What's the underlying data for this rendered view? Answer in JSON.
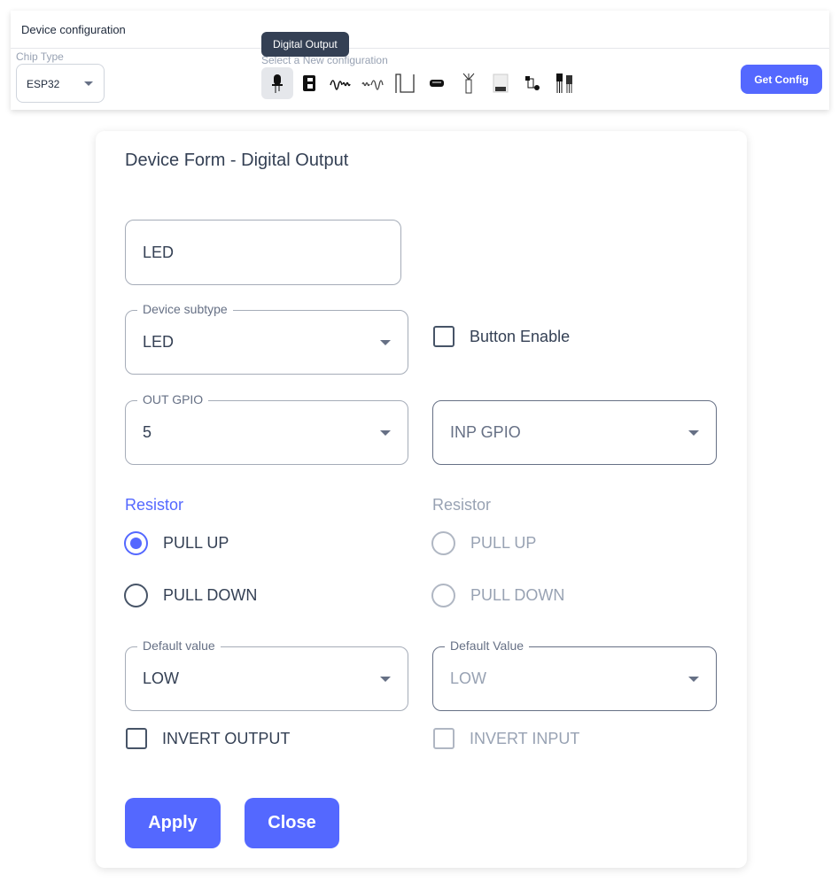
{
  "header": {
    "title": "Device configuration",
    "chip_label": "Chip Type",
    "chip_value": "ESP32",
    "select_label": "Select a New configuration",
    "tooltip": "Digital Output",
    "get_config": "Get Config",
    "icons": [
      "led-icon",
      "relay-icon",
      "analog-wave-icon",
      "pwm-wave-icon",
      "pulse-icon",
      "connector-icon",
      "antenna-icon",
      "bus-icon",
      "circuit-icon",
      "transistor-icon"
    ]
  },
  "form": {
    "title": "Device Form - Digital Output",
    "name_value": "LED",
    "subtype_label": "Device subtype",
    "subtype_value": "LED",
    "button_enable": "Button Enable",
    "out_gpio_label": "OUT GPIO",
    "out_gpio_value": "5",
    "inp_gpio_placeholder": "INP GPIO",
    "resistor_left": "Resistor",
    "resistor_right": "Resistor",
    "pull_up": "PULL UP",
    "pull_down": "PULL DOWN",
    "default_value_label": "Default value",
    "default_value": "LOW",
    "default_value_label_right": "Default Value",
    "default_value_right": "LOW",
    "invert_output": "INVERT OUTPUT",
    "invert_input": "INVERT INPUT",
    "apply": "Apply",
    "close": "Close"
  },
  "colors": {
    "accent": "#5468ff"
  }
}
